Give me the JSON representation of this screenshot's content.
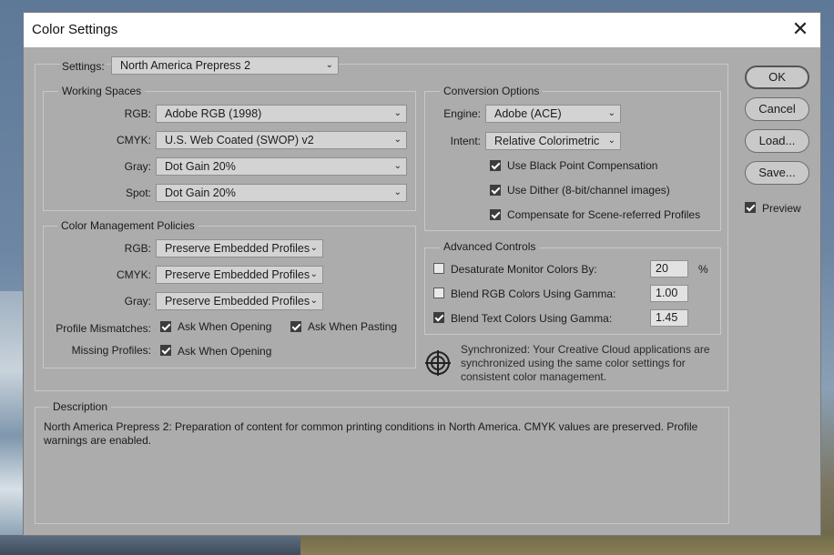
{
  "window": {
    "title": "Color Settings"
  },
  "settings": {
    "label": "Settings:",
    "value": "North America Prepress 2"
  },
  "working_spaces": {
    "legend": "Working Spaces",
    "rows": [
      {
        "label": "RGB:",
        "value": "Adobe RGB (1998)"
      },
      {
        "label": "CMYK:",
        "value": "U.S. Web Coated (SWOP) v2"
      },
      {
        "label": "Gray:",
        "value": "Dot Gain 20%"
      },
      {
        "label": "Spot:",
        "value": "Dot Gain 20%"
      }
    ]
  },
  "policies": {
    "legend": "Color Management Policies",
    "rows": [
      {
        "label": "RGB:",
        "value": "Preserve Embedded Profiles"
      },
      {
        "label": "CMYK:",
        "value": "Preserve Embedded Profiles"
      },
      {
        "label": "Gray:",
        "value": "Preserve Embedded Profiles"
      }
    ],
    "mismatches_label": "Profile Mismatches:",
    "ask_opening": "Ask When Opening",
    "ask_pasting": "Ask When Pasting",
    "missing_label": "Missing Profiles:",
    "missing_ask_opening": "Ask When Opening"
  },
  "conversion": {
    "legend": "Conversion Options",
    "engine_label": "Engine:",
    "engine_value": "Adobe (ACE)",
    "intent_label": "Intent:",
    "intent_value": "Relative Colorimetric",
    "black_point": "Use Black Point Compensation",
    "dither": "Use Dither (8-bit/channel images)",
    "scene_referred": "Compensate for Scene-referred Profiles"
  },
  "advanced": {
    "legend": "Advanced Controls",
    "desaturate_label": "Desaturate Monitor Colors By:",
    "desaturate_value": "20",
    "desaturate_unit": "%",
    "blend_rgb_label": "Blend RGB Colors Using Gamma:",
    "blend_rgb_value": "1.00",
    "blend_text_label": "Blend Text Colors Using Gamma:",
    "blend_text_value": "1.45"
  },
  "sync": {
    "text": "Synchronized: Your Creative Cloud applications are synchronized using the same color settings for consistent color management."
  },
  "description": {
    "legend": "Description",
    "text": "North America Prepress 2:  Preparation of content for common printing conditions in North America. CMYK values are preserved. Profile warnings are enabled."
  },
  "buttons": {
    "ok": "OK",
    "cancel": "Cancel",
    "load": "Load...",
    "save": "Save...",
    "preview": "Preview"
  },
  "checkbox_states": {
    "ask_opening": true,
    "ask_pasting": true,
    "missing_ask_opening": true,
    "black_point": true,
    "dither": true,
    "scene_referred": true,
    "desaturate": false,
    "blend_rgb": false,
    "blend_text": true,
    "preview": true
  }
}
